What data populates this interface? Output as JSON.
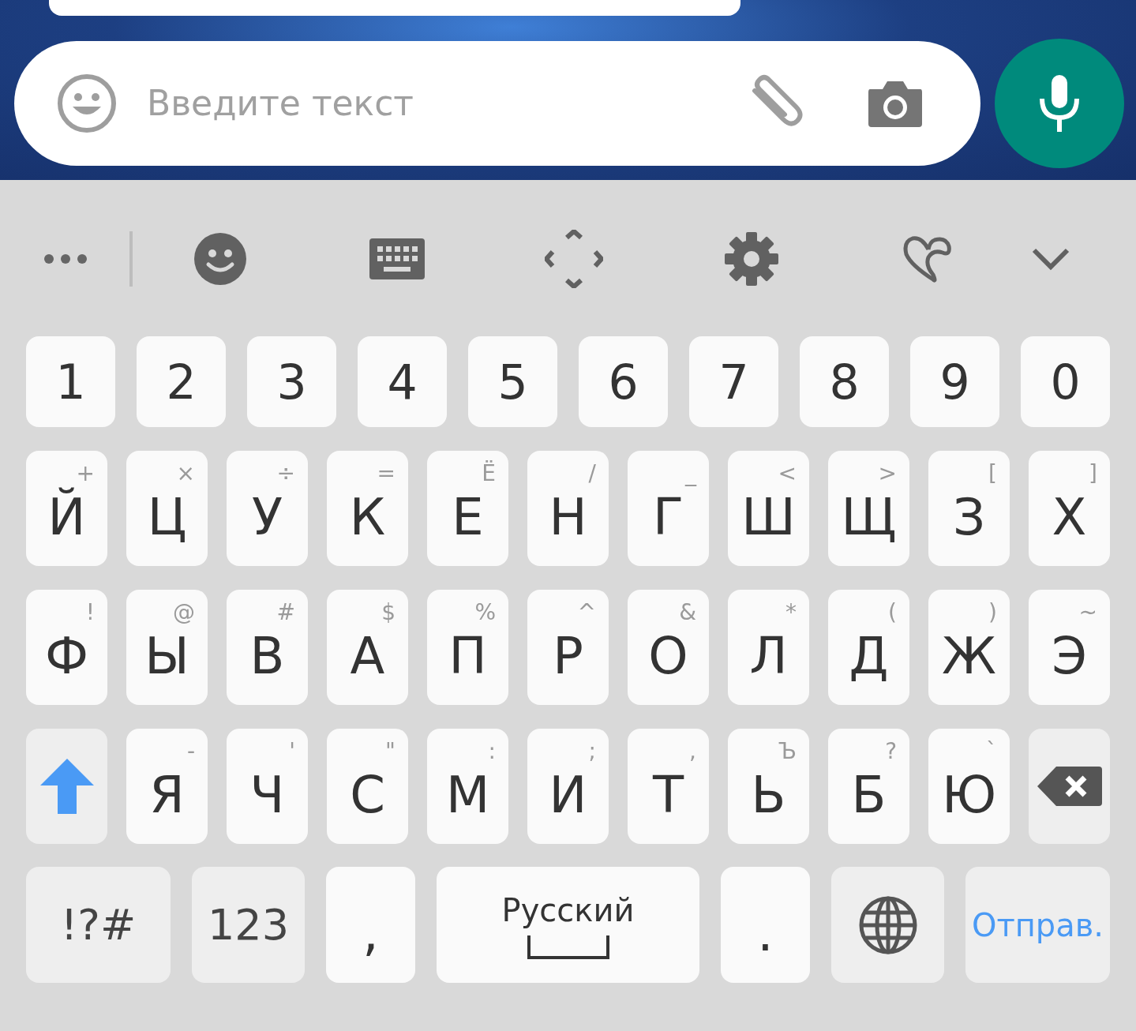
{
  "message_bar": {
    "placeholder": "Введите текст"
  },
  "number_row": [
    "1",
    "2",
    "3",
    "4",
    "5",
    "6",
    "7",
    "8",
    "9",
    "0"
  ],
  "letter_rows": [
    [
      {
        "kind": "letter",
        "label": "Й",
        "secondary": "+"
      },
      {
        "kind": "letter",
        "label": "Ц",
        "secondary": "×"
      },
      {
        "kind": "letter",
        "label": "У",
        "secondary": "÷"
      },
      {
        "kind": "letter",
        "label": "К",
        "secondary": "="
      },
      {
        "kind": "letter",
        "label": "Е",
        "secondary": "Ё"
      },
      {
        "kind": "letter",
        "label": "Н",
        "secondary": "/"
      },
      {
        "kind": "letter",
        "label": "Г",
        "secondary": "_"
      },
      {
        "kind": "letter",
        "label": "Ш",
        "secondary": "<"
      },
      {
        "kind": "letter",
        "label": "Щ",
        "secondary": ">"
      },
      {
        "kind": "letter",
        "label": "З",
        "secondary": "["
      },
      {
        "kind": "letter",
        "label": "Х",
        "secondary": "]"
      }
    ],
    [
      {
        "kind": "letter",
        "label": "Ф",
        "secondary": "!"
      },
      {
        "kind": "letter",
        "label": "Ы",
        "secondary": "@"
      },
      {
        "kind": "letter",
        "label": "В",
        "secondary": "#"
      },
      {
        "kind": "letter",
        "label": "А",
        "secondary": "$"
      },
      {
        "kind": "letter",
        "label": "П",
        "secondary": "%"
      },
      {
        "kind": "letter",
        "label": "Р",
        "secondary": "^"
      },
      {
        "kind": "letter",
        "label": "О",
        "secondary": "&"
      },
      {
        "kind": "letter",
        "label": "Л",
        "secondary": "*"
      },
      {
        "kind": "letter",
        "label": "Д",
        "secondary": "("
      },
      {
        "kind": "letter",
        "label": "Ж",
        "secondary": ")"
      },
      {
        "kind": "letter",
        "label": "Э",
        "secondary": "~"
      }
    ],
    [
      {
        "kind": "shift",
        "on": true
      },
      {
        "kind": "letter",
        "label": "Я",
        "secondary": "-"
      },
      {
        "kind": "letter",
        "label": "Ч",
        "secondary": "'"
      },
      {
        "kind": "letter",
        "label": "С",
        "secondary": "\""
      },
      {
        "kind": "letter",
        "label": "М",
        "secondary": ":"
      },
      {
        "kind": "letter",
        "label": "И",
        "secondary": ";"
      },
      {
        "kind": "letter",
        "label": "Т",
        "secondary": ","
      },
      {
        "kind": "letter",
        "label": "Ь",
        "secondary": "Ъ"
      },
      {
        "kind": "letter",
        "label": "Б",
        "secondary": "?"
      },
      {
        "kind": "letter",
        "label": "Ю",
        "secondary": "`"
      },
      {
        "kind": "backspace"
      }
    ]
  ],
  "bottom_row": [
    {
      "kind": "symbols",
      "label": "!?#"
    },
    {
      "kind": "numbers",
      "label": "123"
    },
    {
      "kind": "punct",
      "label": ","
    },
    {
      "kind": "space",
      "label": "Русский"
    },
    {
      "kind": "punct",
      "label": "."
    },
    {
      "kind": "language"
    },
    {
      "kind": "send",
      "label": "Отправ."
    }
  ]
}
